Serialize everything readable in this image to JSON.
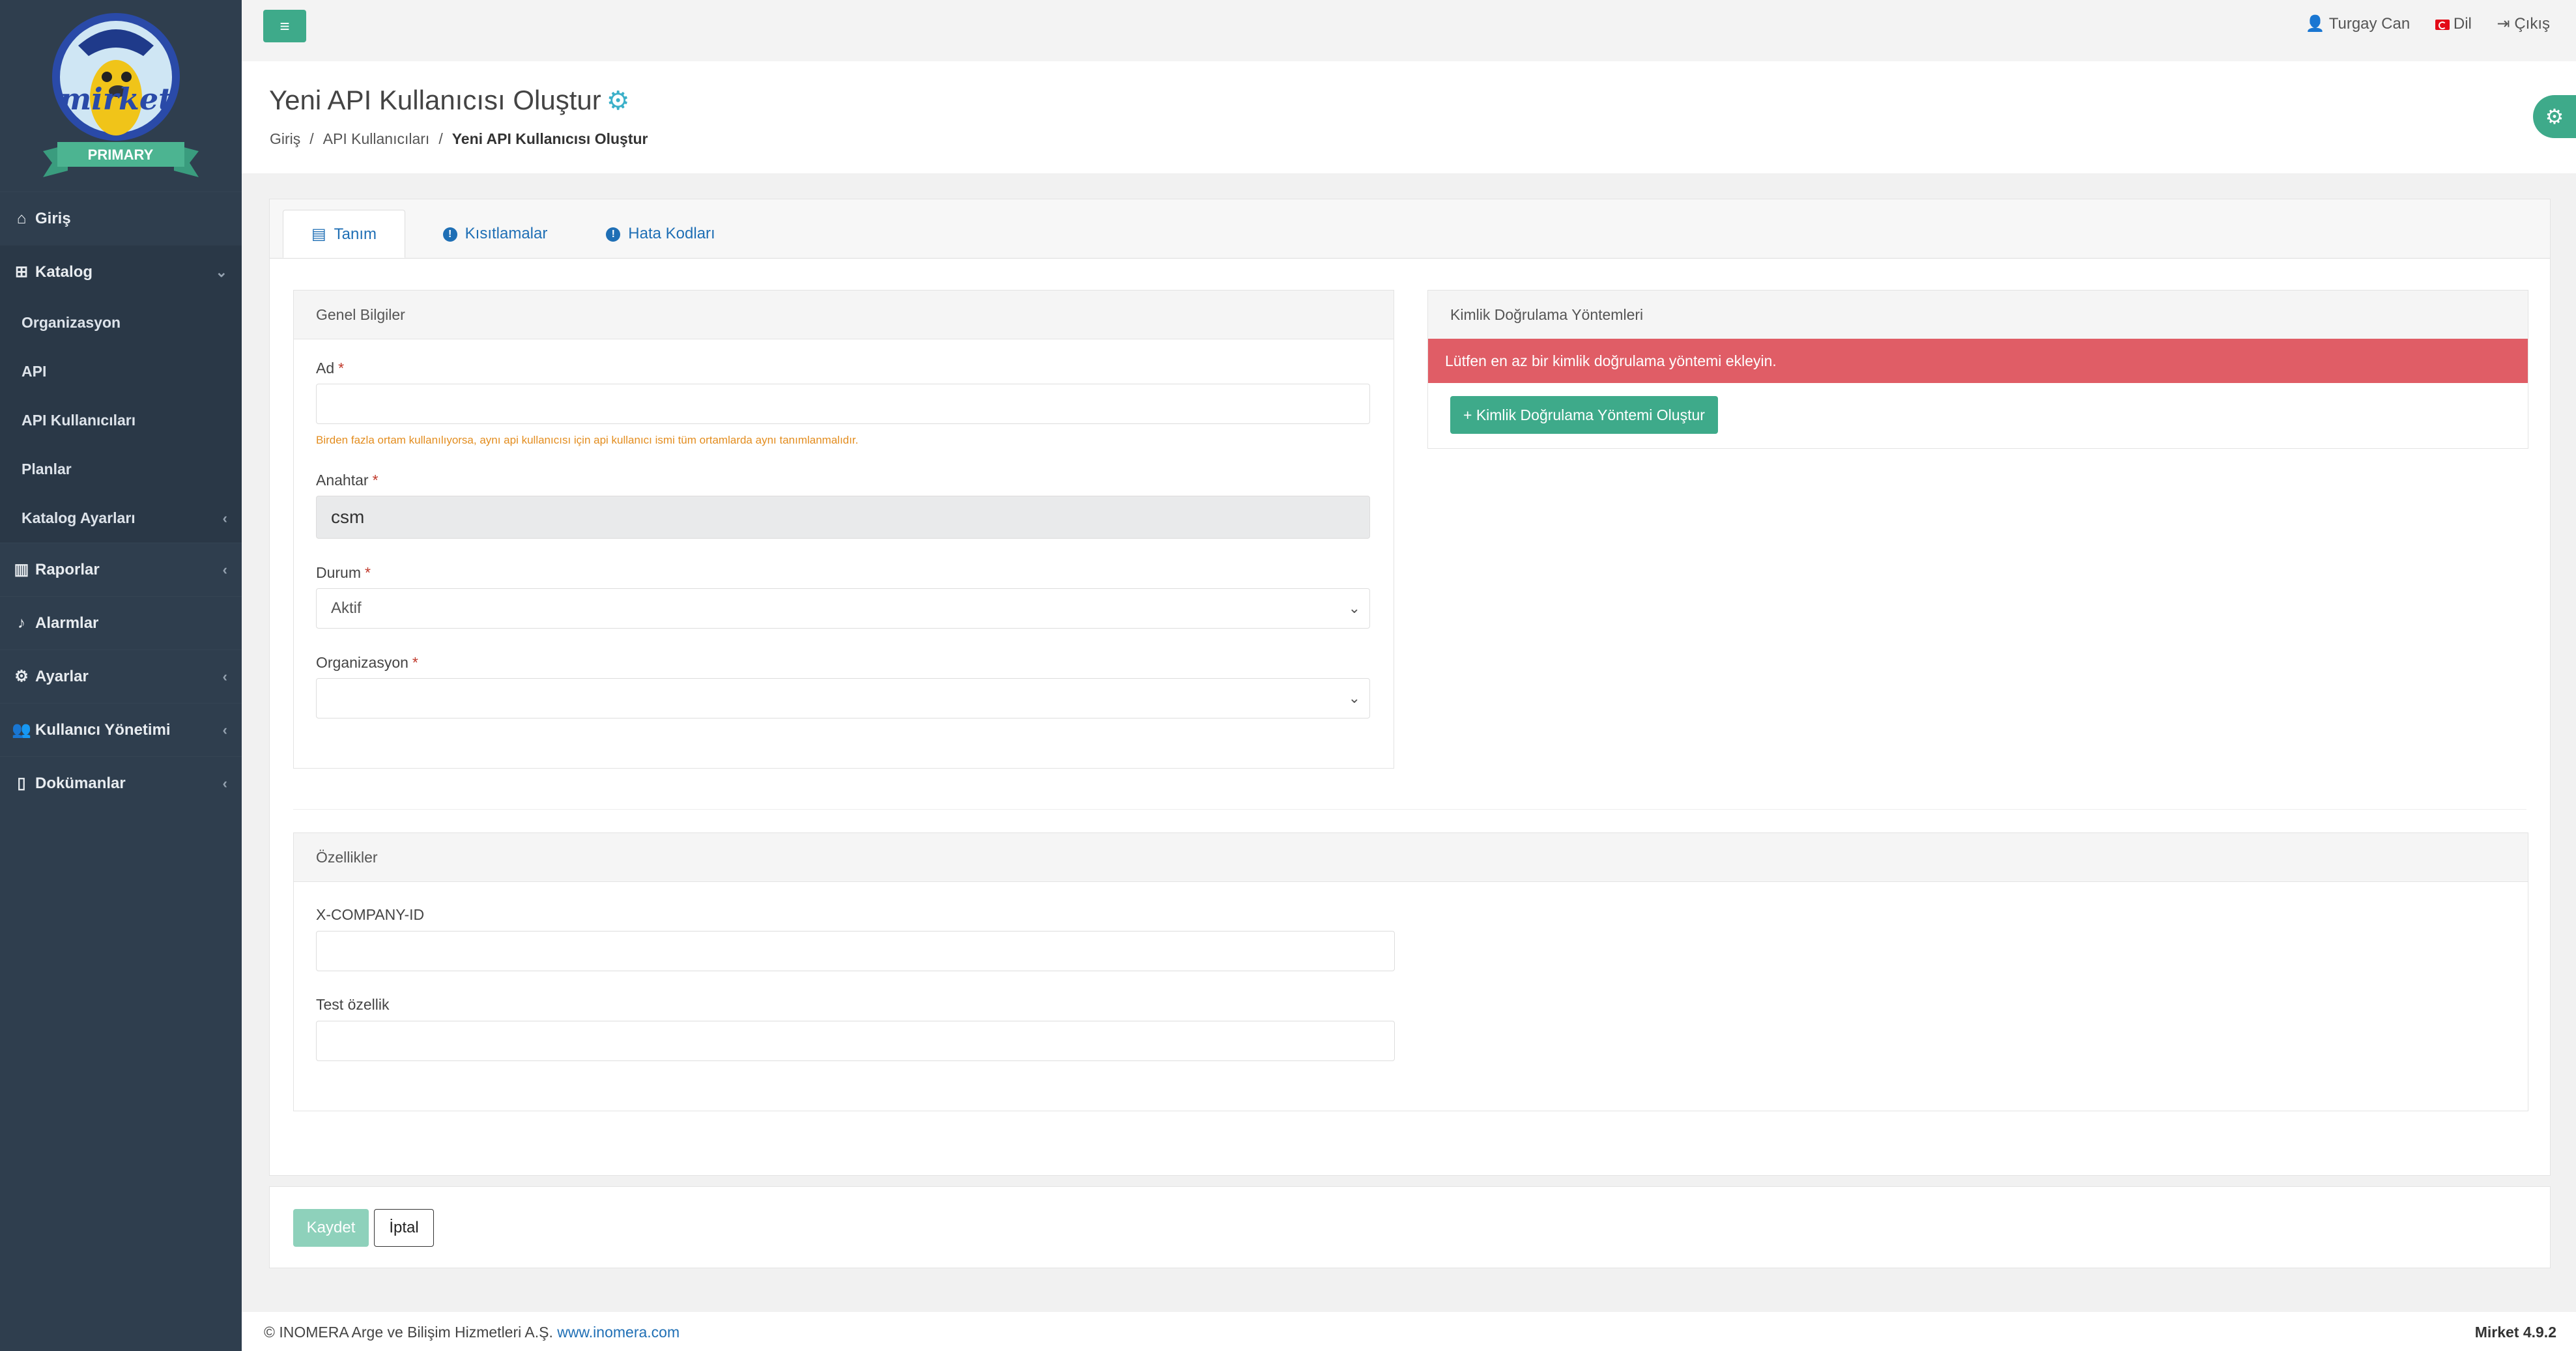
{
  "brand": {
    "logo_text": "mirket",
    "badge": "PRIMARY"
  },
  "sidebar": {
    "items": [
      {
        "label": "Giriş",
        "icon": "home-icon"
      },
      {
        "label": "Katalog",
        "icon": "sitemap-icon"
      },
      {
        "label": "Raporlar",
        "icon": "bar-chart-icon"
      },
      {
        "label": "Alarmlar",
        "icon": "bell-icon"
      },
      {
        "label": "Ayarlar",
        "icon": "gears-icon"
      },
      {
        "label": "Kullanıcı Yönetimi",
        "icon": "users-icon"
      },
      {
        "label": "Dokümanlar",
        "icon": "document-icon"
      }
    ],
    "katalog_sub": [
      "Organizasyon",
      "API",
      "API Kullanıcıları",
      "Planlar",
      "Katalog Ayarları"
    ]
  },
  "topbar": {
    "user": "Turgay Can",
    "lang": "Dil",
    "logout": "Çıkış"
  },
  "header": {
    "title": "Yeni API Kullanıcısı Oluştur",
    "breadcrumb": [
      "Giriş",
      "API Kullanıcıları",
      "Yeni API Kullanıcısı Oluştur"
    ]
  },
  "tabs": [
    "Tanım",
    "Kısıtlamalar",
    "Hata Kodları"
  ],
  "general": {
    "title": "Genel Bilgiler",
    "ad_label": "Ad",
    "ad_value": "",
    "ad_help": "Birden fazla ortam kullanılıyorsa, aynı api kullanıcısı için api kullanıcı ismi tüm ortamlarda aynı tanımlanmalıdır.",
    "anahtar_label": "Anahtar",
    "anahtar_value": "csm",
    "durum_label": "Durum",
    "durum_value": "Aktif",
    "org_label": "Organizasyon",
    "org_value": "",
    "required_mark": "*"
  },
  "auth": {
    "title": "Kimlik Doğrulama Yöntemleri",
    "alert": "Lütfen en az bir kimlik doğrulama yöntemi ekleyin.",
    "create_button": "+ Kimlik Doğrulama Yöntemi Oluştur"
  },
  "props": {
    "title": "Özellikler",
    "fields": [
      {
        "label": "X-COMPANY-ID",
        "value": ""
      },
      {
        "label": "Test özellik",
        "value": ""
      }
    ]
  },
  "actions": {
    "save": "Kaydet",
    "cancel": "İptal"
  },
  "footer": {
    "copyright": "© INOMERA Arge ve Bilişim Hizmetleri A.Ş.",
    "link": "www.inomera.com",
    "version": "Mirket 4.9.2"
  },
  "colors": {
    "sidebar": "#2f3e4e",
    "accent": "#3eaa8a",
    "alert": "#e05d66",
    "link": "#1f6fb5"
  }
}
